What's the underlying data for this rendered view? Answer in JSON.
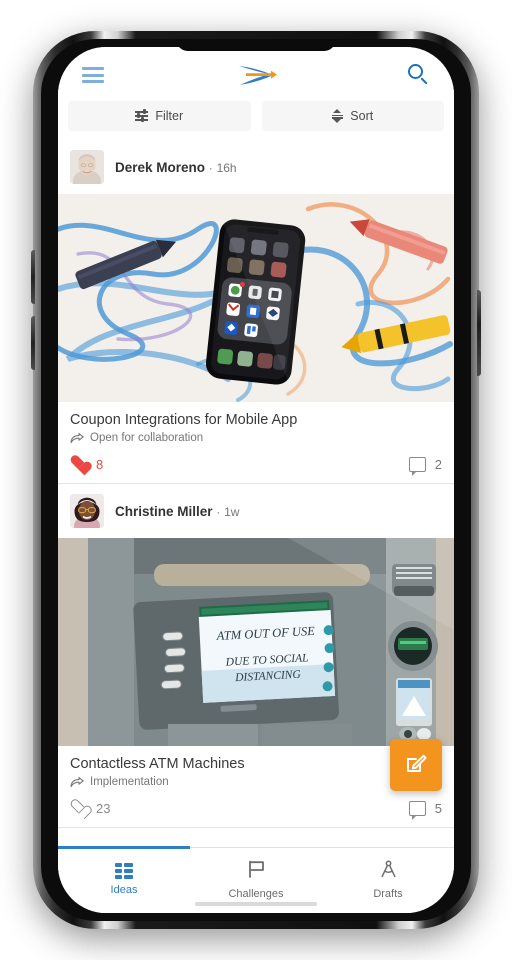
{
  "app": {
    "brand_logo_name": "company-arrow-logo",
    "accent_blue": "#2e7ec4",
    "light_blue": "#7eaedc",
    "accent_orange": "#f2941e",
    "like_red": "#ec4740"
  },
  "app_bar": {
    "menu_icon": "hamburger-menu-icon",
    "search_icon": "search-icon"
  },
  "toolbar": {
    "filter_label": "Filter",
    "sort_label": "Sort",
    "filter_icon": "filter-sliders-icon",
    "sort_icon": "sort-arrows-icon"
  },
  "feed": {
    "posts": [
      {
        "author": "Derek Moreno",
        "time_separator": "·",
        "time": "16h",
        "avatar_name": "avatar-derek-moreno",
        "image_alt": "smartphone on paper with crayon scribbles",
        "title": "Coupon Integrations for Mobile App",
        "stage": "Open for collaboration",
        "stage_icon": "share-arrow-icon",
        "likes": "8",
        "liked": true,
        "comments": "2"
      },
      {
        "author": "Christine Miller",
        "time_separator": "·",
        "time": "1w",
        "avatar_name": "avatar-christine-miller",
        "image_alt": "ATM machine with out of use sign",
        "image_sign_line1": "ATM OUT OF USE",
        "image_sign_line2": "DUE TO SOCIAL",
        "image_sign_line3": "DISTANCING",
        "title": "Contactless ATM Machines",
        "stage": "Implementation",
        "stage_icon": "share-arrow-icon",
        "likes": "23",
        "liked": false,
        "comments": "5"
      }
    ]
  },
  "fab": {
    "label_icon": "compose-edit-icon"
  },
  "bottom_nav": {
    "items": [
      {
        "label": "Ideas",
        "icon": "grid-ideas-icon",
        "active": true
      },
      {
        "label": "Challenges",
        "icon": "flag-icon",
        "active": false
      },
      {
        "label": "Drafts",
        "icon": "drafting-compass-icon",
        "active": false
      }
    ]
  }
}
